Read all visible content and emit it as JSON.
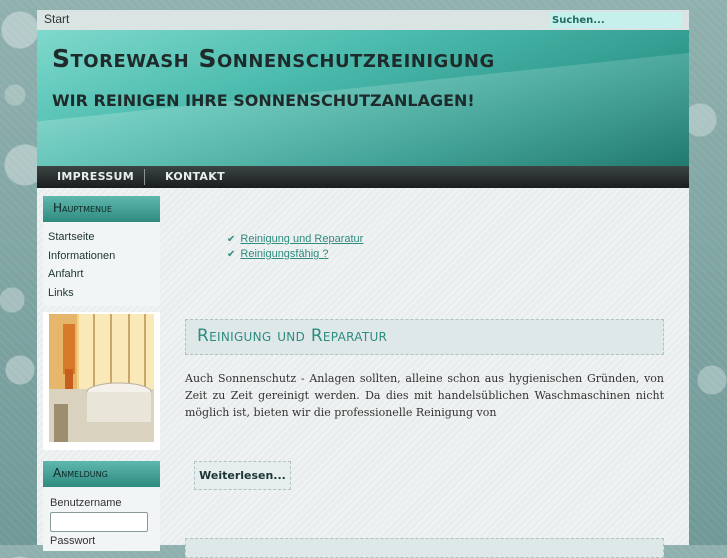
{
  "topbar": {
    "start_label": "Start",
    "search_placeholder": "Suchen..."
  },
  "header": {
    "title": "Storewash Sonnenschutzreinigung",
    "subtitle": "WIR REINIGEN IHRE SONNENSCHUTZANLAGEN!"
  },
  "nav": {
    "items": [
      {
        "label": "IMPRESSUM"
      },
      {
        "label": "KONTAKT"
      }
    ]
  },
  "sidebar": {
    "mainmenu": {
      "heading": "Hauptmenue",
      "items": [
        {
          "label": "Startseite"
        },
        {
          "label": "Informationen"
        },
        {
          "label": "Anfahrt"
        },
        {
          "label": "Links"
        }
      ]
    },
    "login": {
      "heading": "Anmeldung",
      "username_label": "Benutzername",
      "password_label": "Passwort"
    }
  },
  "main": {
    "links": [
      {
        "label": "Reinigung und Reparatur"
      },
      {
        "label": "Reinigungsfähig ?"
      }
    ],
    "article": {
      "title": "Reinigung und Reparatur",
      "text": "Auch Sonnenschutz - Anlagen sollten, alleine schon aus hygienischen Gründen, von Zeit zu Zeit gereinigt werden. Da dies mit handelsüblichen Waschmaschinen nicht möglich ist, bieten wir die professionelle Reinigung von",
      "readmore_label": "Weiterlesen..."
    }
  },
  "icons": {
    "check": "check-icon"
  },
  "colors": {
    "accent": "#2e8b80",
    "header": "#4cbcae",
    "navbar": "#2a3030"
  }
}
